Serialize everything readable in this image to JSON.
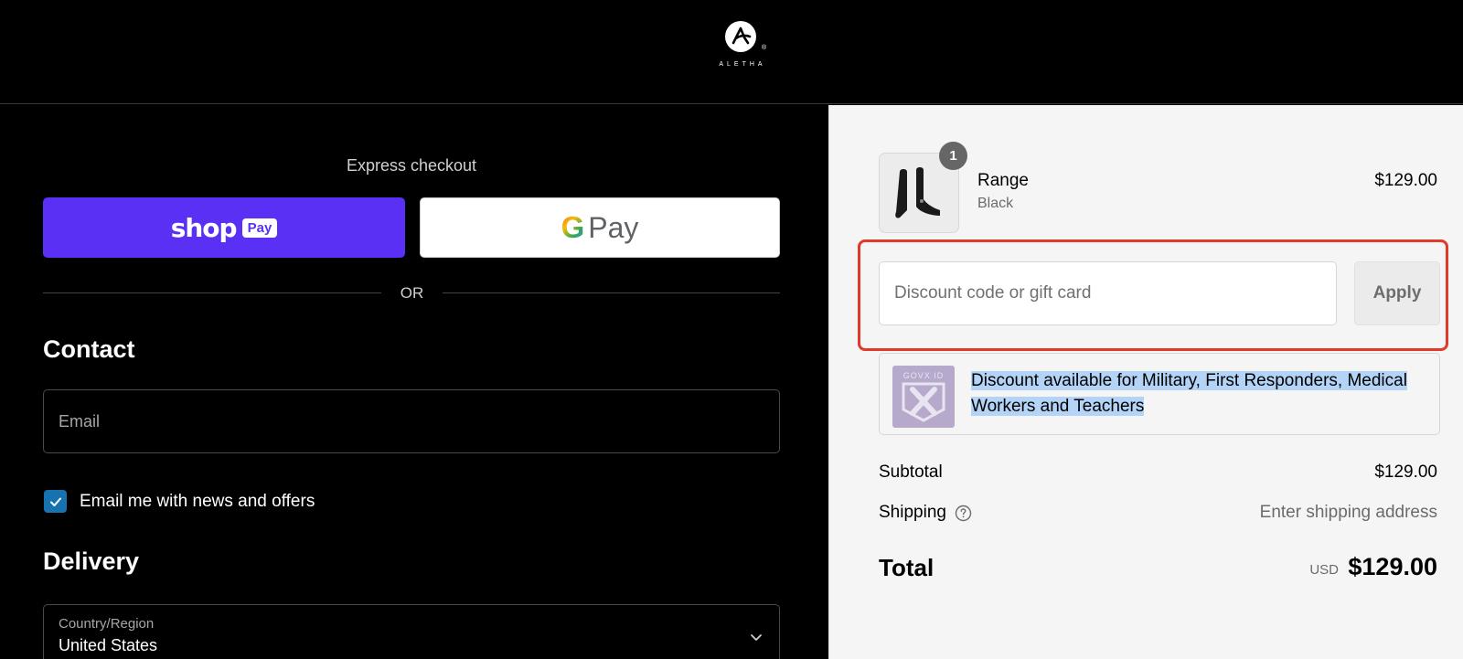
{
  "header": {
    "logo_word": "ALETHA",
    "logo_reg": "®"
  },
  "express": {
    "title": "Express checkout",
    "shop_word": "shop",
    "shop_pay_label": "Pay",
    "gpay_g": "G",
    "gpay_word": "Pay",
    "or_label": "OR"
  },
  "contact": {
    "heading": "Contact",
    "email_placeholder": "Email",
    "newsletter_label": "Email me with news and offers",
    "newsletter_checked": true
  },
  "delivery": {
    "heading": "Delivery",
    "country_label": "Country/Region",
    "country_value": "United States"
  },
  "order": {
    "item": {
      "name": "Range",
      "variant": "Black",
      "price": "$129.00",
      "quantity": "1"
    },
    "discount": {
      "placeholder": "Discount code or gift card",
      "apply_label": "Apply"
    },
    "govx": {
      "logo_text": "GOVX ID",
      "message": "Discount available for Military, First Responders, Medical Workers and Teachers"
    },
    "subtotal_label": "Subtotal",
    "subtotal_value": "$129.00",
    "shipping_label": "Shipping",
    "shipping_value": "Enter shipping address",
    "total_label": "Total",
    "total_currency": "USD",
    "total_value": "$129.00"
  },
  "colors": {
    "shop_pay": "#5a31f4",
    "checkbox": "#1773b0",
    "highlight": "#e03a2a",
    "selection": "#b3d3f7"
  }
}
